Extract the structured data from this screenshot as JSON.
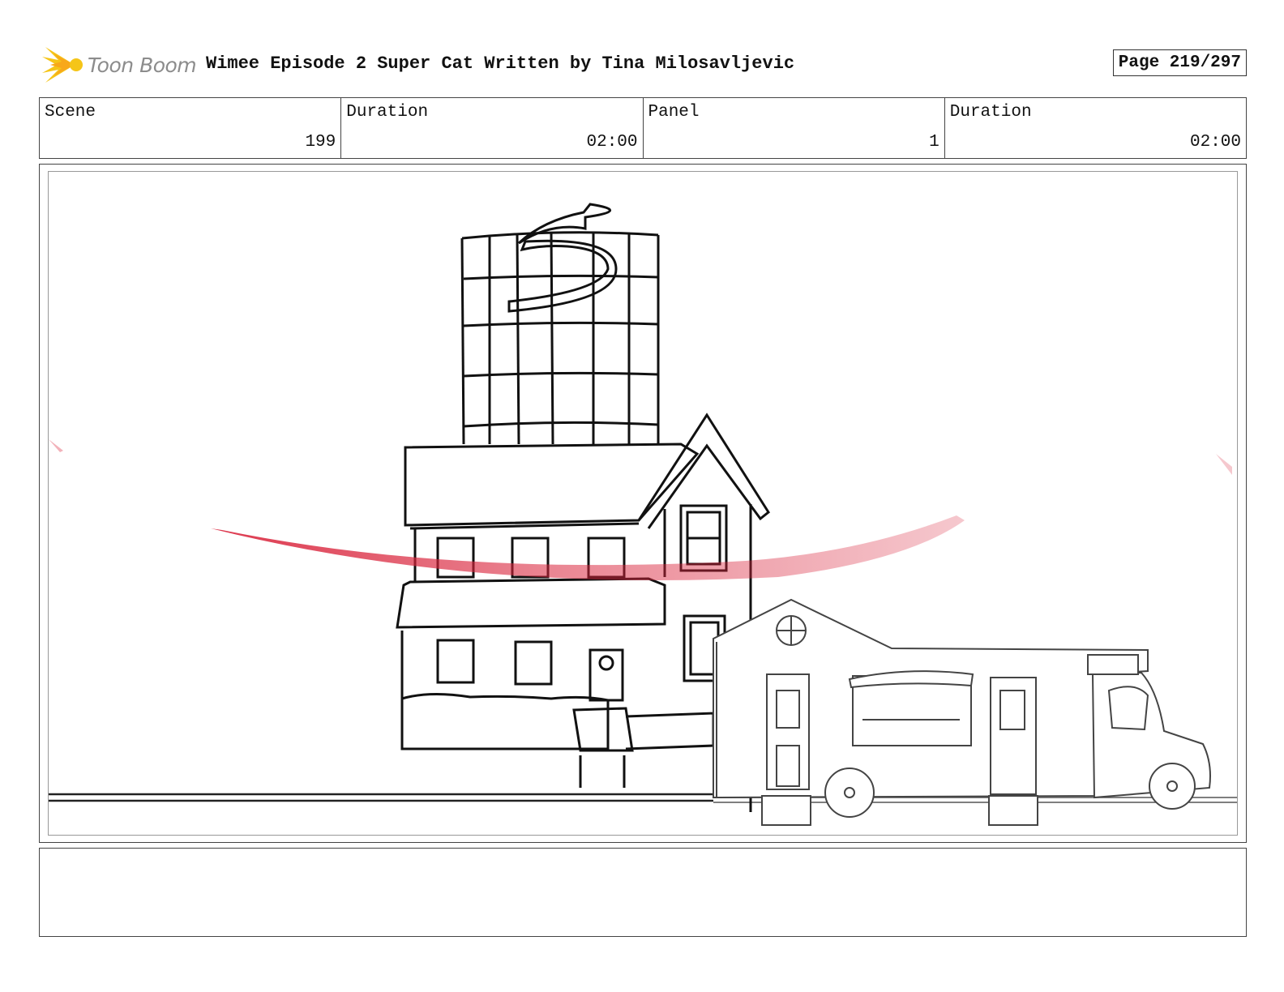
{
  "header": {
    "logo_text": "Toon Boom",
    "title": "Wimee Episode 2 Super Cat  Written by Tina Milosavljevic",
    "page_label": "Page 219/297"
  },
  "info": {
    "scene_label": "Scene",
    "scene_value": "199",
    "scene_duration_label": "Duration",
    "scene_duration_value": "02:00",
    "panel_label": "Panel",
    "panel_value": "1",
    "panel_duration_label": "Duration",
    "panel_duration_value": "02:00"
  },
  "notes": {
    "text": ""
  },
  "colors": {
    "logo_accent": "#f5c518",
    "motion_streak": "#d9223a"
  }
}
